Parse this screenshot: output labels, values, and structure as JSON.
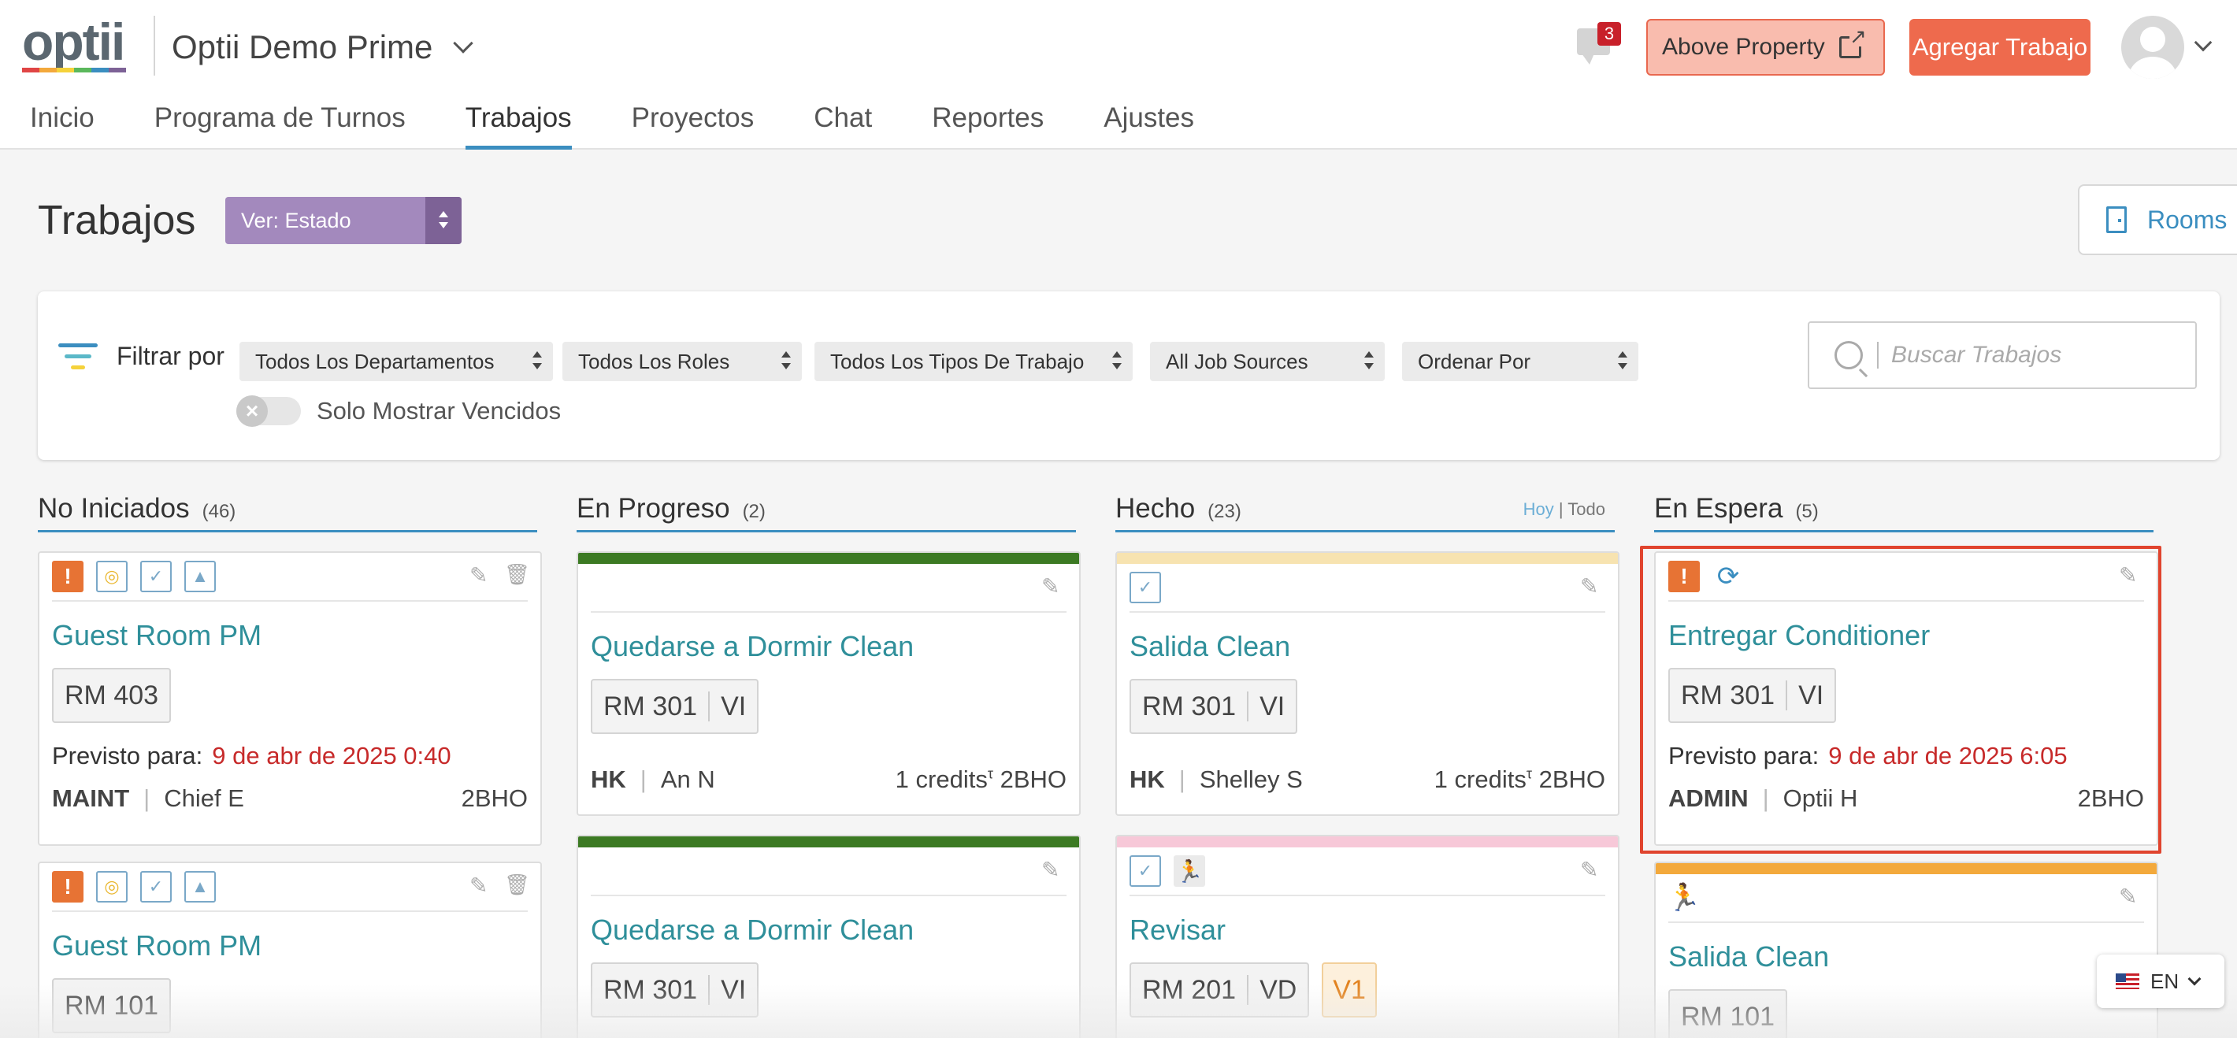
{
  "app": {
    "logo_text": "optii",
    "logo_colors": [
      "#e04545",
      "#f3a93c",
      "#f5d23b",
      "#5bb85c",
      "#3b8ec0",
      "#7d6296"
    ],
    "property": "Optii Demo Prime",
    "notifications_count": "3",
    "above_property_label": "Above Property",
    "add_job_label": "Agregar Trabajo"
  },
  "nav": {
    "items": [
      "Inicio",
      "Programa de Turnos",
      "Trabajos",
      "Proyectos",
      "Chat",
      "Reportes",
      "Ajustes"
    ],
    "active": "Trabajos"
  },
  "page": {
    "title": "Trabajos",
    "view_select": "Ver: Estado",
    "rooms_button": "Rooms"
  },
  "filters": {
    "label": "Filtrar por",
    "departments": "Todos Los Departamentos",
    "roles": "Todos Los Roles",
    "job_types": "Todos Los Tipos De Trabajo",
    "job_sources": "All Job Sources",
    "order_by": "Ordenar Por",
    "overdue_toggle_label": "Solo Mostrar Vencidos",
    "search_placeholder": "Buscar Trabajos"
  },
  "columns": {
    "not_started": {
      "title": "No Iniciados",
      "count": "(46)",
      "cards": [
        {
          "title": "Guest Room PM",
          "room": "RM 403",
          "due_label": "Previsto para:",
          "due_date": "9 de abr de 2025 0:40",
          "dept": "MAINT",
          "assignee": "Chief E",
          "code": "2BHO"
        },
        {
          "title": "Guest Room PM",
          "room": "RM 101"
        }
      ]
    },
    "in_progress": {
      "title": "En Progreso",
      "count": "(2)",
      "stripe_color": "#3c7a23",
      "cards": [
        {
          "title": "Quedarse a Dormir Clean",
          "room": "RM 301",
          "status": "VI",
          "dept": "HK",
          "assignee": "An N",
          "credits": "1 credits",
          "credits_mark": "τ",
          "code": "2BHO"
        },
        {
          "title": "Quedarse a Dormir Clean",
          "room": "RM 301",
          "status": "VI"
        }
      ]
    },
    "done": {
      "title": "Hecho",
      "count": "(23)",
      "link_today": "Hoy",
      "link_sep": "|",
      "link_all": "Todo",
      "cards": [
        {
          "stripe_color": "#f7e3b0",
          "title": "Salida Clean",
          "room": "RM 301",
          "status": "VI",
          "dept": "HK",
          "assignee": "Shelley S",
          "credits": "1 credits",
          "credits_mark": "τ",
          "code": "2BHO"
        },
        {
          "stripe_color": "#f7c8d8",
          "title": "Revisar",
          "room": "RM 201",
          "status": "VD",
          "badge": "V1"
        }
      ]
    },
    "on_hold": {
      "title": "En Espera",
      "count": "(5)",
      "cards": [
        {
          "title": "Entregar Conditioner",
          "room": "RM 301",
          "status": "VI",
          "due_label": "Previsto para:",
          "due_date": "9 de abr de 2025 6:05",
          "dept": "ADMIN",
          "assignee": "Optii H",
          "code": "2BHO"
        },
        {
          "stripe_color": "#f3a93c",
          "title": "Salida Clean",
          "room": "RM 101"
        }
      ]
    }
  },
  "language": {
    "code": "EN"
  },
  "colors": {
    "accent": "#3b8ec0",
    "title_teal": "#2f8f9a",
    "overdue_red": "#c72a2a",
    "alert_orange": "#e77334",
    "highlight_red": "#e0442e"
  }
}
